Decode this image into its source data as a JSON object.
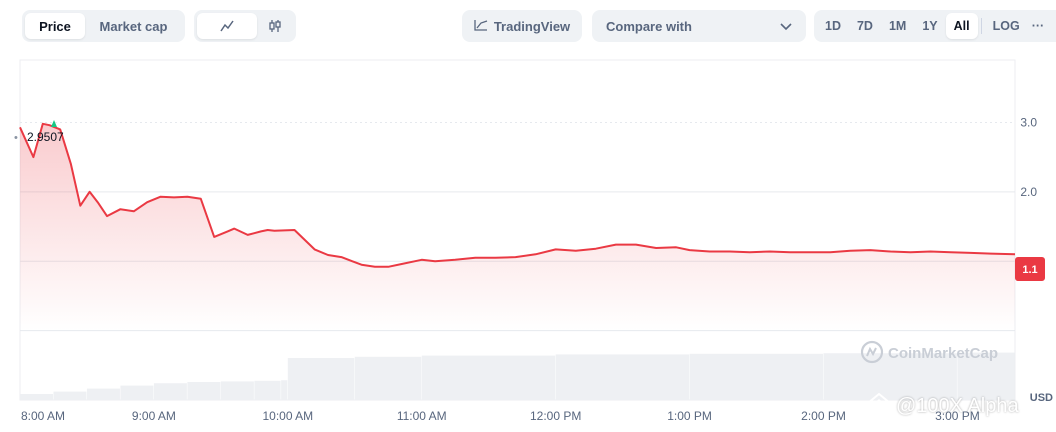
{
  "toolbar": {
    "metric_tabs": [
      {
        "label": "Price",
        "active": true
      },
      {
        "label": "Market cap",
        "active": false
      }
    ],
    "chart_types": [
      {
        "icon": "line-chart-icon",
        "active": true
      },
      {
        "icon": "candlestick-icon",
        "active": false
      }
    ],
    "tradingview_label": "TradingView",
    "compare_label": "Compare with",
    "ranges": [
      {
        "label": "1D",
        "active": false
      },
      {
        "label": "7D",
        "active": false
      },
      {
        "label": "1M",
        "active": false
      },
      {
        "label": "1Y",
        "active": false
      },
      {
        "label": "All",
        "active": true
      }
    ],
    "log_label": "LOG",
    "more_label": "···"
  },
  "watermark": {
    "cmc_text": "CoinMarketCap",
    "overlay_text": "@100X Alpha"
  },
  "colors": {
    "line": "#ea3943",
    "price_tag_bg": "#ea3943",
    "high_marker": "#16c784",
    "grid": "#e6e9ee",
    "volume": "#eef0f3",
    "axis_text": "#58667e"
  },
  "chart_data": {
    "type": "area",
    "x_ticks": [
      "8:00 AM",
      "9:00 AM",
      "10:00 AM",
      "11:00 AM",
      "12:00 PM",
      "1:00 PM",
      "2:00 PM",
      "3:00 PM"
    ],
    "x_range_hours": [
      8.0,
      15.43
    ],
    "y_ticks": [
      {
        "value": 3.0,
        "label": "3.0"
      },
      {
        "value": 2.0,
        "label": "2.0"
      }
    ],
    "ylim": [
      -1.0,
      3.9
    ],
    "y_unit": "USD",
    "high_label": "2.9507",
    "high_value": 2.95,
    "current_label": "1.1",
    "current_value": 1.1,
    "series": [
      {
        "x": [
          8.0,
          8.1,
          8.17,
          8.22,
          8.3,
          8.38,
          8.45,
          8.52,
          8.58,
          8.65,
          8.75,
          8.85,
          8.95,
          9.05,
          9.15,
          9.25,
          9.35,
          9.45,
          9.55,
          9.6,
          9.7,
          9.8,
          9.85,
          9.9,
          10.05,
          10.2,
          10.3,
          10.4,
          10.48,
          10.55,
          10.65,
          10.75,
          10.85,
          10.95,
          11.0,
          11.1,
          11.25,
          11.4,
          11.55,
          11.7,
          11.85,
          12.0,
          12.15,
          12.3,
          12.45,
          12.6,
          12.75,
          12.9,
          13.0,
          13.15,
          13.3,
          13.45,
          13.6,
          13.75,
          13.9,
          14.05,
          14.2,
          14.35,
          14.5,
          14.65,
          14.8,
          14.95,
          15.1,
          15.25,
          15.43
        ],
        "y": [
          2.93,
          2.5,
          2.98,
          2.96,
          2.9,
          2.4,
          1.8,
          2.0,
          1.85,
          1.65,
          1.75,
          1.72,
          1.85,
          1.93,
          1.92,
          1.93,
          1.9,
          1.35,
          1.43,
          1.47,
          1.38,
          1.43,
          1.45,
          1.44,
          1.45,
          1.17,
          1.09,
          1.06,
          1.0,
          0.95,
          0.92,
          0.92,
          0.96,
          1.0,
          1.02,
          1.0,
          1.02,
          1.05,
          1.05,
          1.06,
          1.1,
          1.17,
          1.15,
          1.18,
          1.24,
          1.24,
          1.19,
          1.2,
          1.16,
          1.14,
          1.14,
          1.13,
          1.14,
          1.13,
          1.13,
          1.13,
          1.15,
          1.16,
          1.14,
          1.13,
          1.14,
          1.13,
          1.12,
          1.11,
          1.1
        ]
      }
    ],
    "volume": {
      "x": [
        8.0,
        8.25,
        8.5,
        8.75,
        9.0,
        9.25,
        9.5,
        9.75,
        9.95,
        10.0,
        10.5,
        11.0,
        12.0,
        13.0,
        14.0,
        15.0,
        15.43
      ],
      "y": [
        0.1,
        0.14,
        0.19,
        0.24,
        0.28,
        0.3,
        0.31,
        0.32,
        0.33,
        0.7,
        0.72,
        0.74,
        0.76,
        0.77,
        0.78,
        0.79,
        0.8
      ]
    }
  }
}
